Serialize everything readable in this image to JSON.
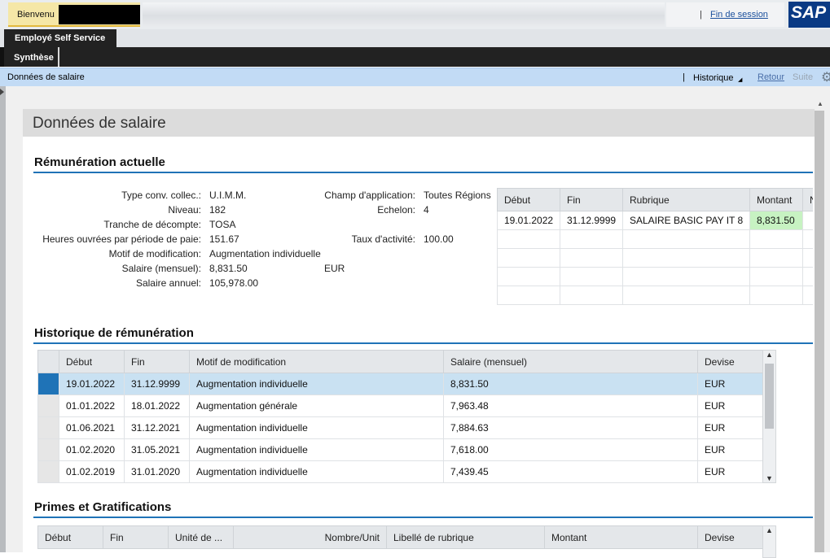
{
  "header": {
    "welcome_label": "Bienvenu",
    "separator": "|",
    "logout_label": "Fin de session",
    "logo_text": "SAP"
  },
  "nav": {
    "level1_tab": "Employé Self Service",
    "level2_tab": "Synthèse"
  },
  "toolbar": {
    "page_title": "Données de salaire",
    "separator": "|",
    "history_label": "Historique",
    "back_label": "Retour",
    "next_label": "Suite",
    "settings_icon": "gear-icon"
  },
  "page": {
    "heading": "Données de salaire"
  },
  "current": {
    "section_title": "Rémunération actuelle",
    "fields_left": [
      {
        "label": "Type conv. collec.:",
        "value": "U.I.M.M."
      },
      {
        "label": "Niveau:",
        "value": "182"
      },
      {
        "label": "Tranche de décompte:",
        "value": "TOSA"
      },
      {
        "label": "Heures ouvrées par période de paie:",
        "value": "151.67"
      },
      {
        "label": "Motif de modification:",
        "value": "Augmentation individuelle"
      },
      {
        "label": "Salaire (mensuel):",
        "value": "8,831.50"
      },
      {
        "label": "Salaire annuel:",
        "value": "105,978.00"
      }
    ],
    "salary_currency": "EUR",
    "fields_right": [
      {
        "label": "Champ d'application:",
        "value": "Toutes Régions"
      },
      {
        "label": "Echelon:",
        "value": "4"
      },
      {
        "label": "Taux d'activité:",
        "value": "100.00"
      }
    ],
    "grid": {
      "headers": [
        "Début",
        "Fin",
        "Rubrique",
        "Montant",
        "N"
      ],
      "rows": [
        [
          "19.01.2022",
          "31.12.9999",
          "SALAIRE BASIC PAY IT 8",
          "8,831.50",
          ""
        ]
      ],
      "highlight_color": "#c7f2c2"
    }
  },
  "history": {
    "section_title": "Historique de rémunération",
    "headers": [
      "Début",
      "Fin",
      "Motif de modification",
      "Salaire (mensuel)",
      "Devise"
    ],
    "rows": [
      [
        "19.01.2022",
        "31.12.9999",
        "Augmentation individuelle",
        "8,831.50",
        "EUR"
      ],
      [
        "01.01.2022",
        "18.01.2022",
        "Augmentation générale",
        "7,963.48",
        "EUR"
      ],
      [
        "01.06.2021",
        "31.12.2021",
        "Augmentation individuelle",
        "7,884.63",
        "EUR"
      ],
      [
        "01.02.2020",
        "31.05.2021",
        "Augmentation individuelle",
        "7,618.00",
        "EUR"
      ],
      [
        "01.02.2019",
        "31.01.2020",
        "Augmentation individuelle",
        "7,439.45",
        "EUR"
      ]
    ],
    "selected_row": 0
  },
  "bonuses": {
    "section_title": "Primes et Gratifications",
    "headers": [
      "Début",
      "Fin",
      "Unité de ...",
      "Nombre/Unit",
      "Libellé de rubrique",
      "Montant",
      "Devise"
    ]
  },
  "colors": {
    "accent_blue": "#1f73b7",
    "crumb_bar": "#c2dbf5",
    "nav_dark": "#222222"
  }
}
